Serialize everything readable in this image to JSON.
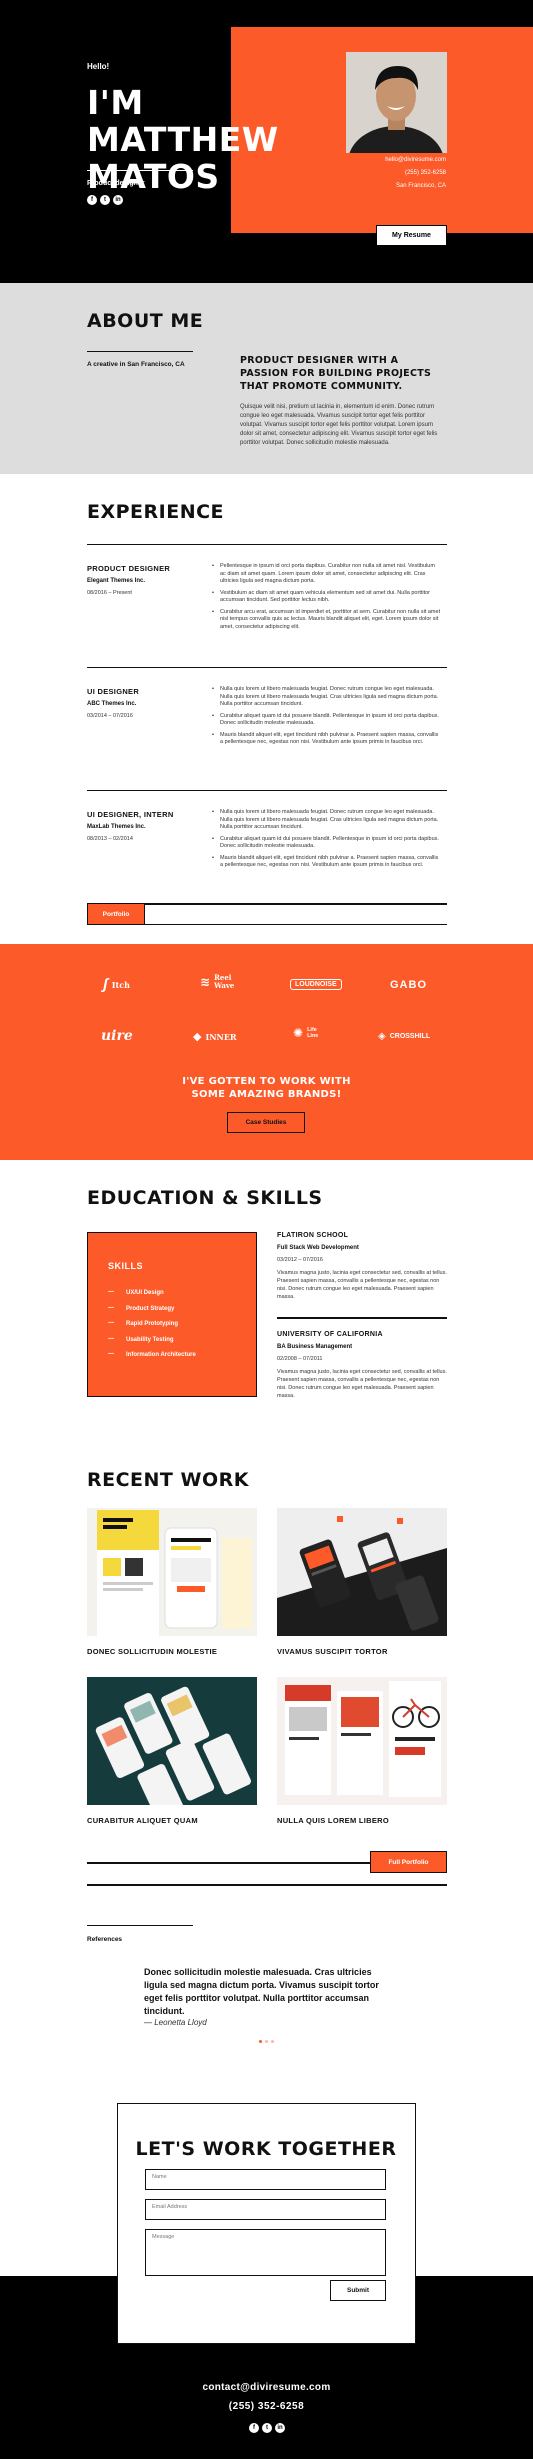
{
  "hero": {
    "hello": "Hello!",
    "name": "I'M MATTHEW MATOS",
    "role": "Product designer",
    "email": "hello@diviresume.com",
    "phone": "(255) 352-6258",
    "location": "San Francisco, CA",
    "resume_button": "My Resume",
    "socials": [
      "facebook-icon",
      "twitter-icon",
      "linkedin-icon"
    ]
  },
  "about": {
    "title": "ABOUT ME",
    "creative": "A creative in San Francisco, CA",
    "headline": "PRODUCT DESIGNER WITH A PASSION FOR BUILDING PROJECTS THAT PROMOTE COMMUNITY.",
    "body": "Quisque velit nisi, pretium ut lacinia in, elementum id enim. Donec rutrum congue leo eget malesuada. Vivamus suscipit tortor eget felis porttitor volutpat. Vivamus suscipit tortor eget felis porttitor volutpat. Lorem ipsum dolor sit amet, consectetur adipiscing elit. Vivamus suscipit tortor eget felis porttitor volutpat. Donec sollicitudin molestie malesuada."
  },
  "experience": {
    "title": "EXPERIENCE",
    "jobs": [
      {
        "title": "PRODUCT DESIGNER",
        "company": "Elegant Themes Inc.",
        "dates": "08/2016 – Present",
        "bullets": [
          "Pellentesque in ipsum id orci porta dapibus. Curabitur non nulla sit amet nisl. Vestibulum ac diam sit amet quam. Lorem ipsum dolor sit amet, consectetur adipiscing elit. Cras ultricies ligula sed magna dictum porta.",
          "Vestibulum ac diam sit amet quam vehicula elementum sed sit amet dui. Nulla porttitor accumsan tincidunt. Sed porttitor lectus nibh.",
          "Curabitur arcu erat, accumsan id imperdiet et, porttitor at sem. Curabitur non nulla sit amet nisl tempus convallis quis ac lectus. Mauris blandit aliquet elit, eget. Lorem ipsum dolor sit amet, consectetur adipiscing elit."
        ]
      },
      {
        "title": "UI DESIGNER",
        "company": "ABC Themes Inc.",
        "dates": "03/2014 – 07/2016",
        "bullets": [
          "Nulla quis lorem ut libero malesuada feugiat. Donec rutrum congue leo eget malesuada. Nulla quis lorem ut libero malesuada feugiat. Cras ultricies ligula sed magna dictum porta. Nulla porttitor accumsan tincidunt.",
          "Curabitur aliquet quam id dui posuere blandit. Pellentesque in ipsum id orci porta dapibus. Donec sollicitudin molestie malesuada.",
          "Mauris blandit aliquet elit, eget tincidunt nibh pulvinar a. Praesent sapien massa, convallis a pellentesque nec, egestas non nisi. Vestibulum ante ipsum primis in faucibus orci."
        ]
      },
      {
        "title": "UI DESIGNER, INTERN",
        "company": "MaxLab Themes Inc.",
        "dates": "08/2013 – 02/2014",
        "bullets": [
          "Nulla quis lorem ut libero malesuada feugiat. Donec rutrum congue leo eget malesuada. Nulla quis lorem ut libero malesuada feugiat. Cras ultricies ligula sed magna dictum porta. Nulla porttitor accumsan tincidunt.",
          "Curabitur aliquet quam id dui posuere blandit. Pellentesque in ipsum id orci porta dapibus. Donec sollicitudin molestie malesuada.",
          "Mauris blandit aliquet elit, eget tincidunt nibh pulvinar a. Praesent sapien massa, convallis a pellentesque nec, egestas non nisi. Vestibulum ante ipsum primis in faucibus orci."
        ]
      }
    ],
    "portfolio_button": "Portfolio"
  },
  "brands": {
    "logos": [
      "Itch",
      "Reel Wave",
      "LOUDNOISE",
      "GABO",
      "uire",
      "INNER",
      "Life Line",
      "CROSSHILL"
    ],
    "headline": "I'VE GOTTEN TO WORK WITH SOME AMAZING BRANDS!",
    "button": "Case Studies"
  },
  "education": {
    "title": "EDUCATION & SKILLS",
    "skills_title": "SKILLS",
    "skills": [
      "UX/UI Design",
      "Product Strategy",
      "Rapid Prototyping",
      "Usability Testing",
      "Information Architecture"
    ],
    "schools": [
      {
        "name": "FLATIRON SCHOOL",
        "degree": "Full Stack Web Development",
        "dates": "03/2012 – 07/2016",
        "desc": "Vivamus magna justo, lacinia eget consectetur sed, convallis at tellus. Praesent sapien massa, convallis a pellentesque nec, egestas non nisi. Donec rutrum congue leo eget malesuada. Praesent sapien massa."
      },
      {
        "name": "UNIVERSITY OF CALIFORNIA",
        "degree": "BA Business Management",
        "dates": "02/2008 – 07/2011",
        "desc": "Vivamus magna justo, lacinia eget consectetur sed, convallis at tellus. Praesent sapien massa, convallis a pellentesque nec, egestas non nisi. Donec rutrum congue leo eget malesuada. Praesent sapien massa."
      }
    ]
  },
  "work": {
    "title": "RECENT WORK",
    "items": [
      {
        "caption": "DONEC SOLLICITUDIN MOLESTIE"
      },
      {
        "caption": "VIVAMUS SUSCIPIT TORTOR"
      },
      {
        "caption": "CURABITUR ALIQUET QUAM"
      },
      {
        "caption": "NULLA QUIS LOREM LIBERO"
      }
    ],
    "button": "Full Portfolio"
  },
  "references": {
    "label": "References",
    "quote": "Donec sollicitudin molestie malesuada. Cras ultricies ligula sed magna dictum porta. Vivamus suscipit tortor eget felis porttitor volutpat. Nulla porttitor accumsan tincidunt.",
    "author": "— Leonetta Lloyd"
  },
  "contact": {
    "title": "LET'S WORK TOGETHER",
    "name_placeholder": "Name",
    "email_placeholder": "Email Address",
    "message_placeholder": "Message",
    "submit": "Submit",
    "email": "contact@diviresume.com",
    "phone": "(255) 352-6258"
  },
  "colors": {
    "accent": "#fc5a29",
    "dark": "#000000",
    "light_gray": "#dddddd"
  }
}
